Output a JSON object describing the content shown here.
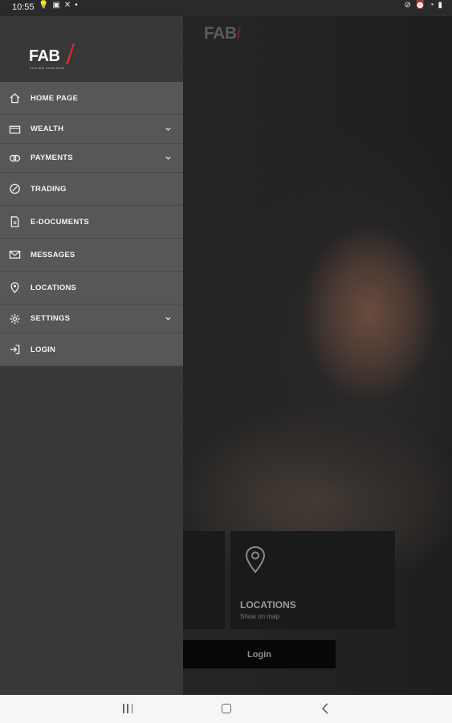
{
  "status": {
    "time": "10:55"
  },
  "background": {
    "logo": "FAB",
    "tile_title": "LOCATIONS",
    "tile_sub": "Show on map",
    "login_label": "Login"
  },
  "drawer": {
    "brand": "FAB",
    "brand_tagline": "First Abu Dhabi Bank",
    "menu": [
      {
        "label": "HOME PAGE",
        "icon": "home-icon"
      },
      {
        "label": "WEALTH",
        "icon": "wallet-icon",
        "expandable": true
      },
      {
        "label": "PAYMENTS",
        "icon": "cash-icon",
        "expandable": true
      },
      {
        "label": "TRADING",
        "icon": "trading-icon"
      },
      {
        "label": "E-DOCUMENTS",
        "icon": "document-icon"
      },
      {
        "label": "MESSAGES",
        "icon": "mail-icon"
      },
      {
        "label": "LOCATIONS",
        "icon": "location-icon"
      },
      {
        "label": "SETTINGS",
        "icon": "gear-icon",
        "expandable": true
      },
      {
        "label": "LOGIN",
        "icon": "login-icon"
      }
    ]
  }
}
